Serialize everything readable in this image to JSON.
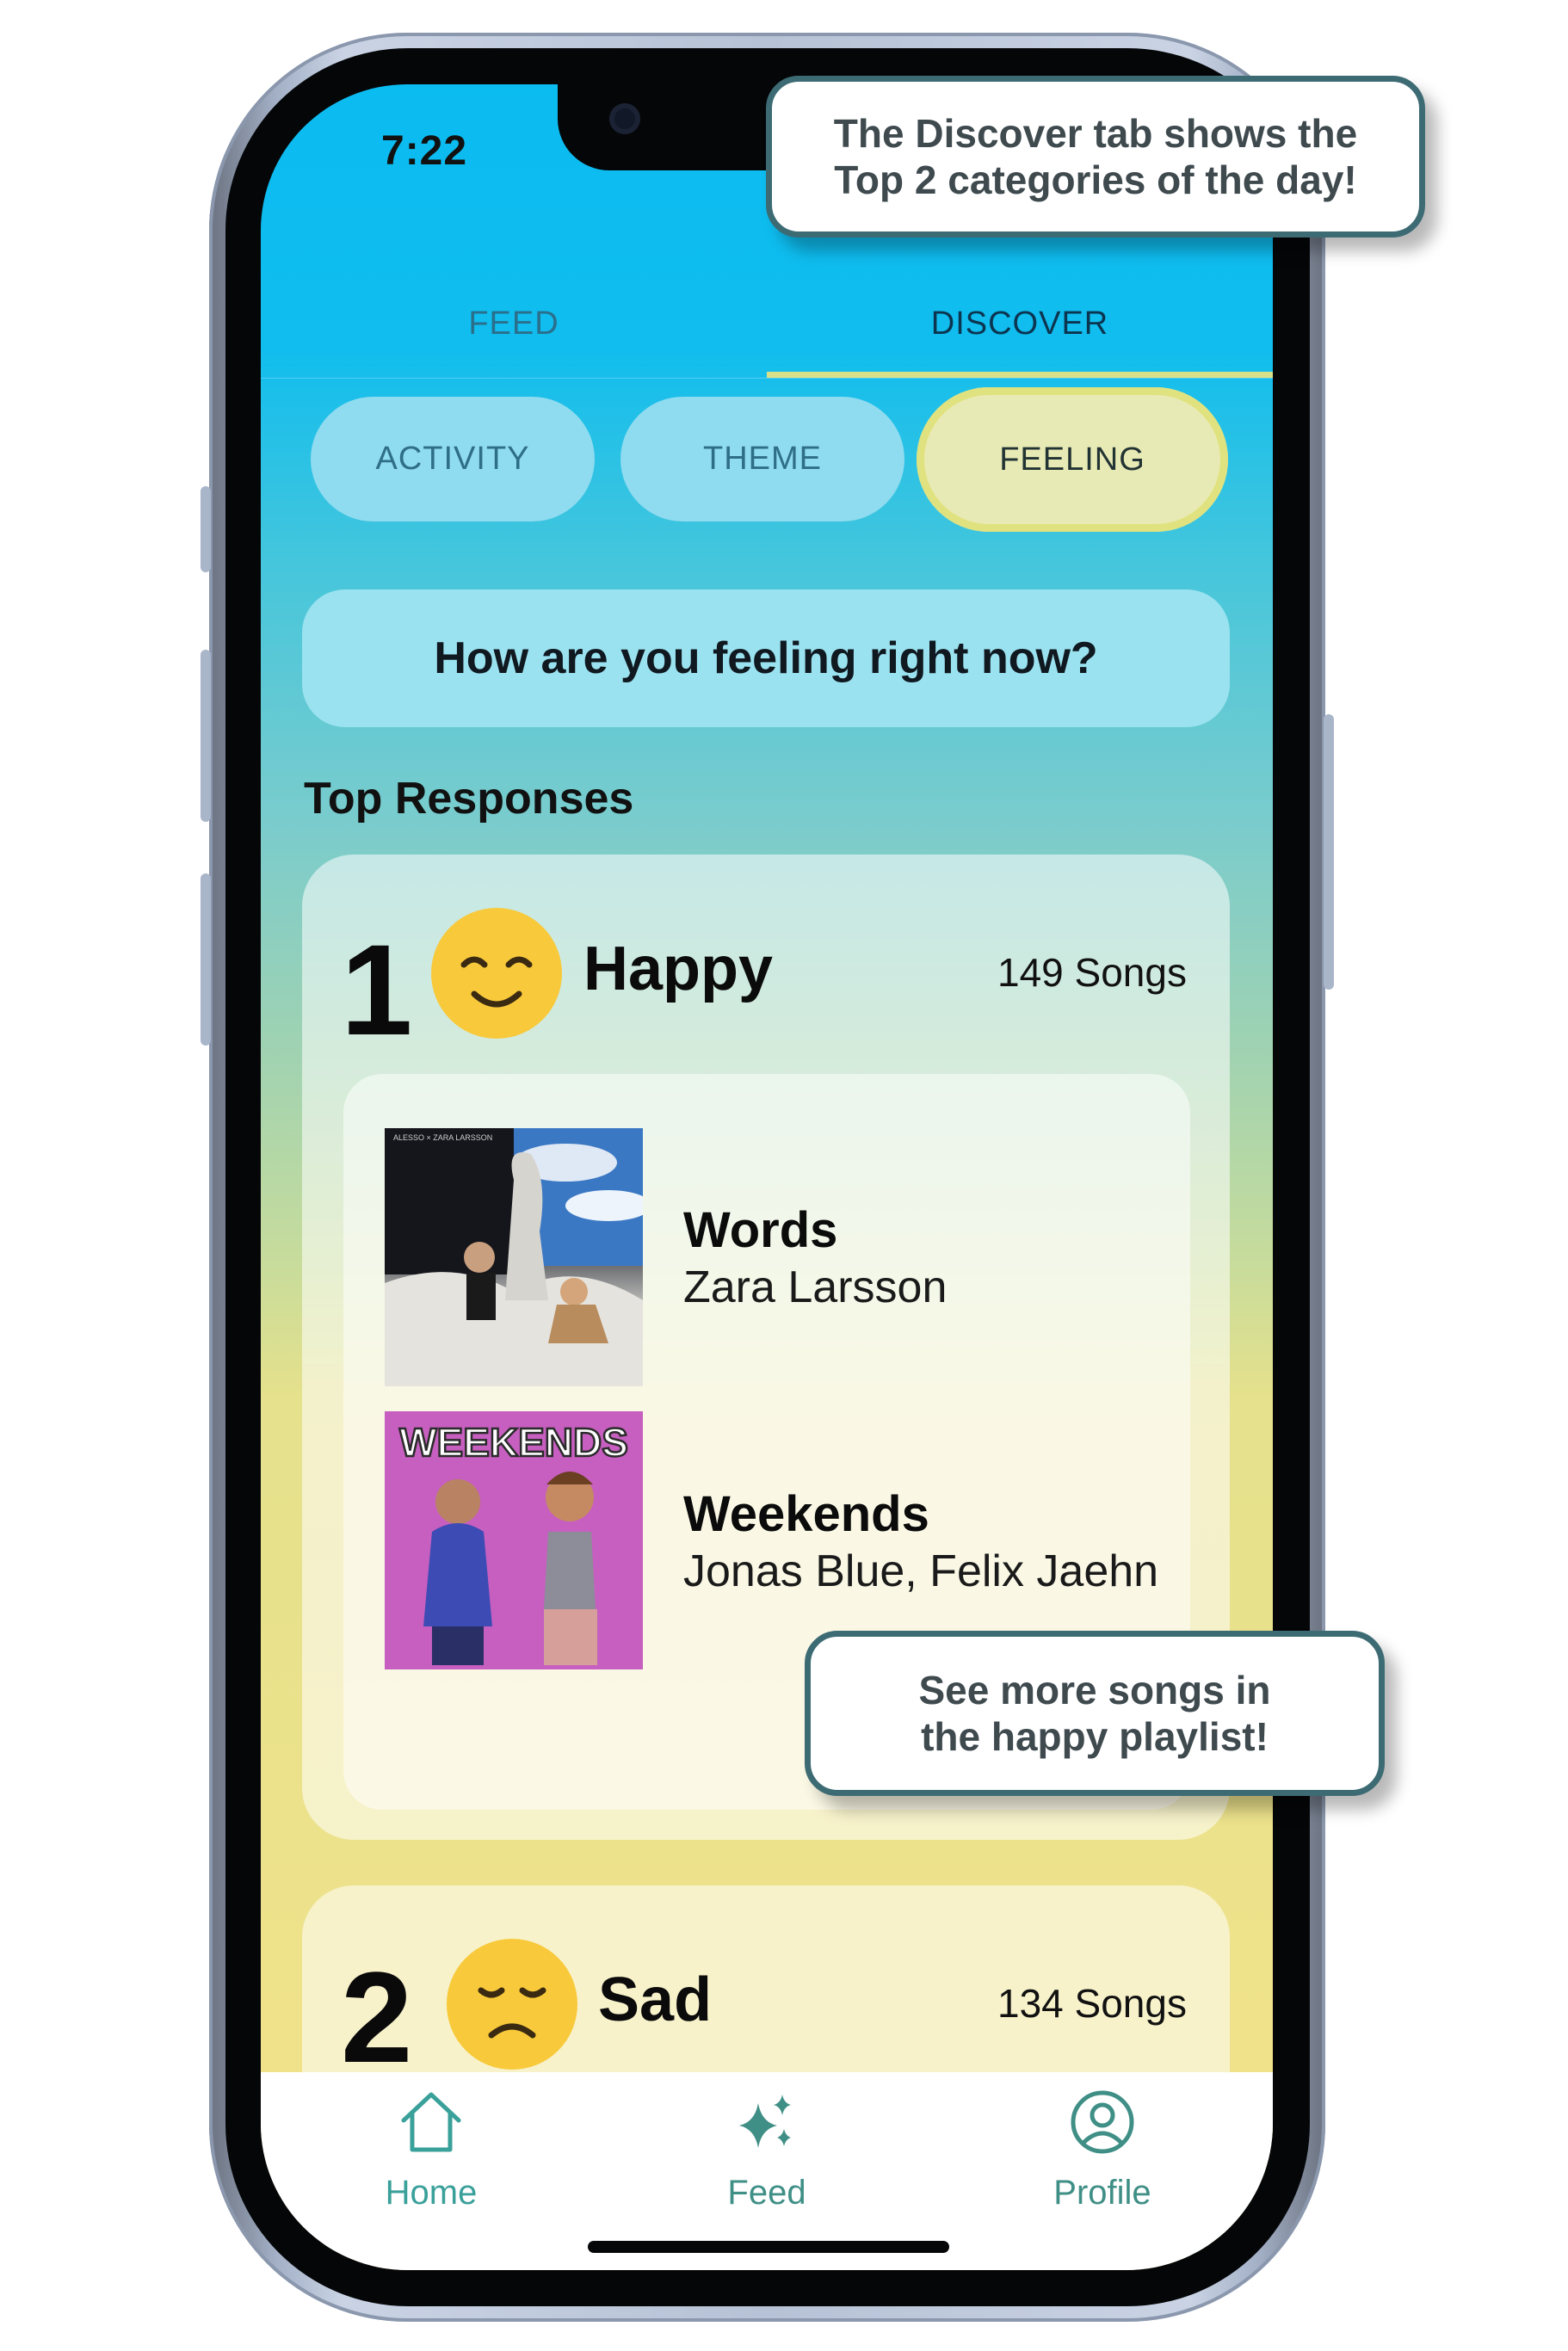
{
  "status_bar": {
    "time": "7:22"
  },
  "tabs": [
    {
      "label": "FEED",
      "active": false
    },
    {
      "label": "DISCOVER",
      "active": true
    }
  ],
  "filters": [
    {
      "label": "ACTIVITY",
      "active": false
    },
    {
      "label": "THEME",
      "active": false
    },
    {
      "label": "FEELING",
      "active": true
    }
  ],
  "question": "How are you feeling right now?",
  "section_title": "Top Responses",
  "categories": [
    {
      "rank": "1",
      "emoji": "smiling-face-icon",
      "name": "Happy",
      "count": "149 Songs",
      "songs": [
        {
          "title": "Words",
          "artist": "Zara Larsson",
          "art": "words-album-art"
        },
        {
          "title": "Weekends",
          "artist": "Jonas Blue, Felix Jaehn",
          "art": "weekends-album-art",
          "art_text": "WEEKENDS"
        }
      ]
    },
    {
      "rank": "2",
      "emoji": "sad-face-icon",
      "name": "Sad",
      "count": "134 Songs"
    }
  ],
  "bottom_nav": [
    {
      "label": "Home",
      "icon": "home-icon",
      "color": "#3aa09a"
    },
    {
      "label": "Feed",
      "icon": "sparkles-icon",
      "color": "#3f8f86"
    },
    {
      "label": "Profile",
      "icon": "profile-icon",
      "color": "#3f8f86"
    }
  ],
  "callouts": {
    "discover": [
      "The Discover tab shows the",
      "Top 2 categories of the day!"
    ],
    "playlist": [
      "See more songs in",
      "the happy playlist!"
    ]
  },
  "colors": {
    "gradient_top": "#0bbcf1",
    "gradient_bottom": "#f3e28a",
    "active_accent": "#e0e27f",
    "callout_border": "#3d6b74"
  }
}
